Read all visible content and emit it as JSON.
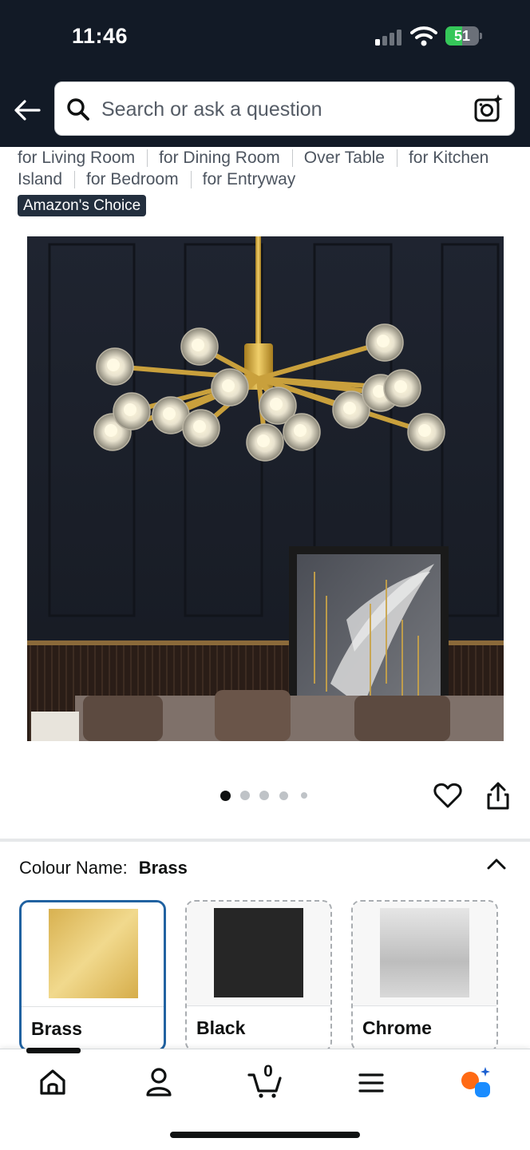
{
  "status_bar": {
    "time": "11:46",
    "battery_level": "51",
    "battery_percent": 51
  },
  "header": {
    "search_placeholder": "Search or ask a question",
    "back_icon": "arrow-left-icon",
    "search_icon": "magnifier-icon",
    "camera_icon": "camera-lens-icon"
  },
  "tags": [
    "for Living Room",
    "for Dining Room",
    "Over Table",
    "for Kitchen Island",
    "for Bedroom",
    "for Entryway"
  ],
  "badge": "Amazon's Choice",
  "gallery": {
    "image_count": 5,
    "current_index": 1
  },
  "variant": {
    "label": "Colour Name:",
    "selected": "Brass",
    "options": [
      {
        "name": "Brass",
        "color": "#e2c067"
      },
      {
        "name": "Black",
        "color": "#262626"
      },
      {
        "name": "Chrome",
        "color": "#cfcfcf"
      }
    ]
  },
  "bottom_nav": {
    "items": [
      "home-icon",
      "account-icon",
      "cart-icon",
      "menu-icon",
      "rufus-assistant-icon"
    ],
    "cart_count": "0"
  },
  "colors": {
    "header_bg": "#121a26",
    "accent_blue": "#2162a1",
    "badge_bg": "#232f3e",
    "battery_green": "#35c759"
  }
}
